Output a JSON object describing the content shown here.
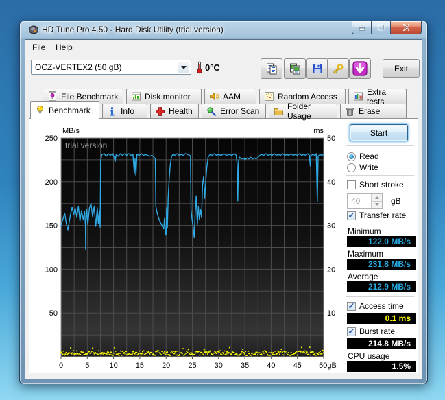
{
  "window": {
    "title": "HD Tune Pro 4.50 - Hard Disk Utility (trial version)",
    "controls": {
      "minimize": "minimize",
      "maximize": "maximize",
      "close": "close"
    }
  },
  "menu": {
    "items": [
      {
        "label": "File"
      },
      {
        "label": "Help"
      }
    ]
  },
  "toolbar": {
    "drive_select": "OCZ-VERTEX2 (50 gB)",
    "temperature": "0°C",
    "buttons": [
      "copy-text",
      "copy-image",
      "save",
      "options",
      "update"
    ],
    "exit_label": "Exit"
  },
  "tabs": {
    "row1": [
      {
        "label": "File Benchmark"
      },
      {
        "label": "Disk monitor"
      },
      {
        "label": "AAM"
      },
      {
        "label": "Random Access"
      },
      {
        "label": "Extra tests"
      }
    ],
    "row2": [
      {
        "label": "Benchmark",
        "active": true
      },
      {
        "label": "Info"
      },
      {
        "label": "Health"
      },
      {
        "label": "Error Scan"
      },
      {
        "label": "Folder Usage"
      },
      {
        "label": "Erase"
      }
    ]
  },
  "panel": {
    "start": "Start",
    "read": "Read",
    "write": "Write",
    "short_stroke": "Short stroke",
    "short_stroke_value": "40",
    "short_stroke_unit": "gB",
    "transfer_rate": "Transfer rate",
    "minimum_label": "Minimum",
    "minimum_value": "122.0 MB/s",
    "maximum_label": "Maximum",
    "maximum_value": "231.8 MB/s",
    "average_label": "Average",
    "average_value": "212.9 MB/s",
    "access_time": "Access time",
    "access_time_value": "0.1 ms",
    "burst_rate": "Burst rate",
    "burst_rate_value": "214.8 MB/s",
    "cpu_usage": "CPU usage",
    "cpu_usage_value": "1.5%"
  },
  "chart_data": {
    "type": "line",
    "watermark": "trial version",
    "left_axis": {
      "label": "MB/s",
      "min": 0,
      "max": 250,
      "tick_step": 50,
      "grid_step": 25
    },
    "right_axis": {
      "label": "ms",
      "min": 0,
      "max": 50,
      "tick_step": 10
    },
    "x_axis": {
      "min": 0,
      "max": 50,
      "tick_step": 5,
      "grid_step": 2.5,
      "last_tick_label": "50gB",
      "tick_labels": [
        "0",
        "5",
        "10",
        "15",
        "20",
        "25",
        "30",
        "35",
        "40",
        "45",
        "50gB"
      ]
    },
    "grid_color": "#4c4c4c",
    "series": [
      {
        "name": "transfer-rate",
        "axis": "left",
        "color": "#2fa9e4",
        "points": [
          [
            0,
            150
          ],
          [
            0.4,
            158
          ],
          [
            0.7,
            164
          ],
          [
            1.0,
            152
          ],
          [
            1.3,
            145
          ],
          [
            1.7,
            159
          ],
          [
            2.1,
            171
          ],
          [
            2.4,
            162
          ],
          [
            2.7,
            170
          ],
          [
            3.0,
            159
          ],
          [
            3.3,
            172
          ],
          [
            3.6,
            155
          ],
          [
            3.9,
            167
          ],
          [
            4.2,
            157
          ],
          [
            4.5,
            166
          ],
          [
            4.65,
            150
          ],
          [
            4.7,
            122
          ],
          [
            4.75,
            155
          ],
          [
            4.9,
            168
          ],
          [
            5.1,
            151
          ],
          [
            5.4,
            170
          ],
          [
            5.7,
            175
          ],
          [
            6.0,
            160
          ],
          [
            6.3,
            172
          ],
          [
            6.6,
            149
          ],
          [
            6.9,
            170
          ],
          [
            7.1,
            152
          ],
          [
            7.3,
            167
          ],
          [
            7.45,
            148
          ],
          [
            7.55,
            224
          ],
          [
            7.8,
            231
          ],
          [
            8.2,
            232
          ],
          [
            8.6,
            229
          ],
          [
            9.0,
            232
          ],
          [
            9.4,
            230
          ],
          [
            9.8,
            232
          ],
          [
            10.1,
            228
          ],
          [
            10.3,
            223
          ],
          [
            10.5,
            231
          ],
          [
            10.9,
            229
          ],
          [
            11.3,
            232
          ],
          [
            11.7,
            230
          ],
          [
            12.1,
            232
          ],
          [
            12.5,
            230
          ],
          [
            12.9,
            232
          ],
          [
            13.3,
            230
          ],
          [
            13.7,
            231
          ],
          [
            13.95,
            209
          ],
          [
            14.1,
            226
          ],
          [
            14.25,
            207
          ],
          [
            14.45,
            231
          ],
          [
            14.9,
            230
          ],
          [
            15.3,
            232
          ],
          [
            15.7,
            230
          ],
          [
            16.1,
            231
          ],
          [
            16.5,
            230
          ],
          [
            16.9,
            229
          ],
          [
            17.3,
            230
          ],
          [
            17.7,
            228
          ],
          [
            17.95,
            226
          ],
          [
            18.05,
            172
          ],
          [
            18.3,
            164
          ],
          [
            18.55,
            159
          ],
          [
            18.8,
            155
          ],
          [
            19.05,
            152
          ],
          [
            19.3,
            149
          ],
          [
            19.55,
            146
          ],
          [
            19.7,
            158
          ],
          [
            19.85,
            141
          ],
          [
            20.0,
            139
          ],
          [
            20.1,
            170
          ],
          [
            20.25,
            147
          ],
          [
            20.4,
            183
          ],
          [
            20.6,
            204
          ],
          [
            20.8,
            219
          ],
          [
            21.0,
            228
          ],
          [
            21.3,
            231
          ],
          [
            21.7,
            230
          ],
          [
            22.1,
            232
          ],
          [
            22.5,
            230
          ],
          [
            22.9,
            231
          ],
          [
            23.3,
            230
          ],
          [
            23.7,
            232
          ],
          [
            24.1,
            231
          ],
          [
            24.5,
            230
          ],
          [
            24.65,
            229
          ],
          [
            24.75,
            168
          ],
          [
            24.95,
            157
          ],
          [
            25.15,
            149
          ],
          [
            25.35,
            136
          ],
          [
            25.55,
            164
          ],
          [
            25.75,
            184
          ],
          [
            25.95,
            151
          ],
          [
            26.15,
            172
          ],
          [
            26.35,
            157
          ],
          [
            26.55,
            168
          ],
          [
            26.75,
            159
          ],
          [
            26.95,
            197
          ],
          [
            27.15,
            206
          ],
          [
            27.35,
            181
          ],
          [
            27.55,
            199
          ],
          [
            27.75,
            216
          ],
          [
            28.0,
            228
          ],
          [
            28.4,
            231
          ],
          [
            28.8,
            230
          ],
          [
            29.2,
            232
          ],
          [
            29.6,
            230
          ],
          [
            30.0,
            231
          ],
          [
            30.5,
            230
          ],
          [
            31.0,
            232
          ],
          [
            31.5,
            230
          ],
          [
            32.0,
            231
          ],
          [
            32.5,
            230
          ],
          [
            33.0,
            232
          ],
          [
            33.35,
            230
          ],
          [
            33.55,
            219
          ],
          [
            33.65,
            178
          ],
          [
            33.8,
            224
          ],
          [
            34.0,
            228
          ],
          [
            34.35,
            226
          ],
          [
            34.7,
            227
          ],
          [
            35.05,
            225
          ],
          [
            35.4,
            227
          ],
          [
            35.75,
            226
          ],
          [
            36.1,
            228
          ],
          [
            36.45,
            226
          ],
          [
            36.8,
            227
          ],
          [
            37.15,
            226
          ],
          [
            37.5,
            228
          ],
          [
            37.85,
            230
          ],
          [
            38.2,
            231
          ],
          [
            38.6,
            230
          ],
          [
            39.0,
            232
          ],
          [
            39.4,
            230
          ],
          [
            39.8,
            231
          ],
          [
            40.2,
            230
          ],
          [
            40.6,
            232
          ],
          [
            41.0,
            230
          ],
          [
            41.4,
            231
          ],
          [
            41.8,
            230
          ],
          [
            42.2,
            232
          ],
          [
            42.6,
            230
          ],
          [
            43.0,
            231
          ],
          [
            43.4,
            230
          ],
          [
            43.8,
            232
          ],
          [
            44.2,
            230
          ],
          [
            44.6,
            231
          ],
          [
            45.0,
            230
          ],
          [
            45.4,
            232
          ],
          [
            45.8,
            230
          ],
          [
            46.2,
            231
          ],
          [
            46.6,
            230
          ],
          [
            47.0,
            232
          ],
          [
            47.3,
            230
          ],
          [
            47.45,
            218
          ],
          [
            47.6,
            230
          ],
          [
            48.0,
            231
          ],
          [
            48.35,
            230
          ],
          [
            48.6,
            232
          ],
          [
            48.8,
            177
          ],
          [
            48.95,
            229
          ],
          [
            49.3,
            231
          ],
          [
            49.6,
            230
          ],
          [
            50,
            231
          ]
        ]
      }
    ],
    "access_time_series": {
      "name": "access-time",
      "axis": "right",
      "color": "#ffff00",
      "value_ms": 0.1,
      "band_min_ms": 0.25,
      "band_max_ms": 1.35,
      "count": 300,
      "seed": 13
    },
    "stats": {
      "minimum": 122.0,
      "maximum": 231.8,
      "average": 212.9,
      "access_time_ms": 0.1,
      "burst_rate": 214.8,
      "cpu_usage_pct": 1.5
    }
  }
}
